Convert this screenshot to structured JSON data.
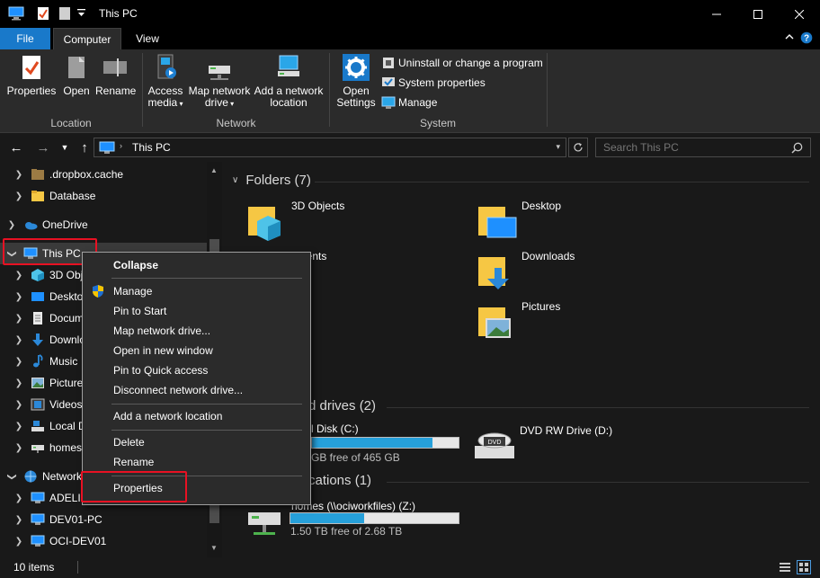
{
  "window": {
    "title": "This PC",
    "minimize_icon": "minimize-icon",
    "maximize_icon": "maximize-icon",
    "close_icon": "close-icon"
  },
  "ribbon_tabs": [
    "File",
    "Computer",
    "View"
  ],
  "ribbon": {
    "location_group": {
      "label": "Location",
      "buttons": [
        "Properties",
        "Open",
        "Rename"
      ]
    },
    "network_group": {
      "label": "Network",
      "access_media_1": "Access",
      "access_media_2": "media",
      "map_drive_1": "Map network",
      "map_drive_2": "drive",
      "add_location_1": "Add a network",
      "add_location_2": "location"
    },
    "system_group": {
      "label": "System",
      "open_settings_1": "Open",
      "open_settings_2": "Settings",
      "uninstall": "Uninstall or change a program",
      "system_properties": "System properties",
      "manage": "Manage"
    }
  },
  "address": {
    "path": "This PC",
    "search_placeholder": "Search This PC"
  },
  "nav_pane": {
    "items": [
      {
        "label": ".dropbox.cache",
        "icon": "folder-icon"
      },
      {
        "label": "Database",
        "icon": "folder-icon"
      },
      {
        "label": "OneDrive",
        "icon": "onedrive-icon"
      },
      {
        "label": "This PC",
        "icon": "pc-icon"
      },
      {
        "label": "3D Obj",
        "icon": "3d-objects-icon"
      },
      {
        "label": "Deskto",
        "icon": "desktop-icon"
      },
      {
        "label": "Docum",
        "icon": "documents-icon"
      },
      {
        "label": "Downlo",
        "icon": "downloads-icon"
      },
      {
        "label": "Music",
        "icon": "music-icon"
      },
      {
        "label": "Picture",
        "icon": "pictures-icon"
      },
      {
        "label": "Videos",
        "icon": "videos-icon"
      },
      {
        "label": "Local D",
        "icon": "local-disk-icon"
      },
      {
        "label": "homes",
        "icon": "network-drive-icon"
      },
      {
        "label": "Network",
        "icon": "network-icon"
      },
      {
        "label": "ADELIN",
        "icon": "computer-icon"
      },
      {
        "label": "DEV01-PC",
        "icon": "computer-icon"
      },
      {
        "label": "OCI-DEV01",
        "icon": "computer-icon"
      }
    ]
  },
  "content": {
    "folders_header": "Folders (7)",
    "folders": [
      "3D Objects",
      "Desktop",
      "uments",
      "Downloads",
      "ic",
      "Pictures",
      "os"
    ],
    "drives_header": "d drives (2)",
    "local_disk_label": "l Disk (C:)",
    "local_disk_free": "GB free of 465 GB",
    "local_disk_used_fraction": 0.82,
    "dvd_label": "DVD RW Drive (D:)",
    "locations_header": "cations (1)",
    "homes_label": "homes (\\\\ociworkfiles) (Z:)",
    "homes_free": "1.50 TB free of 2.68 TB",
    "homes_used_fraction": 0.44
  },
  "status": {
    "count": "10 items"
  },
  "context_menu": {
    "items": [
      "Collapse",
      "Manage",
      "Pin to Start",
      "Map network drive...",
      "Open in new window",
      "Pin to Quick access",
      "Disconnect network drive...",
      "Add a network location",
      "Delete",
      "Rename",
      "Properties"
    ]
  },
  "colors": {
    "accent": "#1979ca",
    "highlight": "#e81123",
    "bar_fill": "#26a0da"
  }
}
